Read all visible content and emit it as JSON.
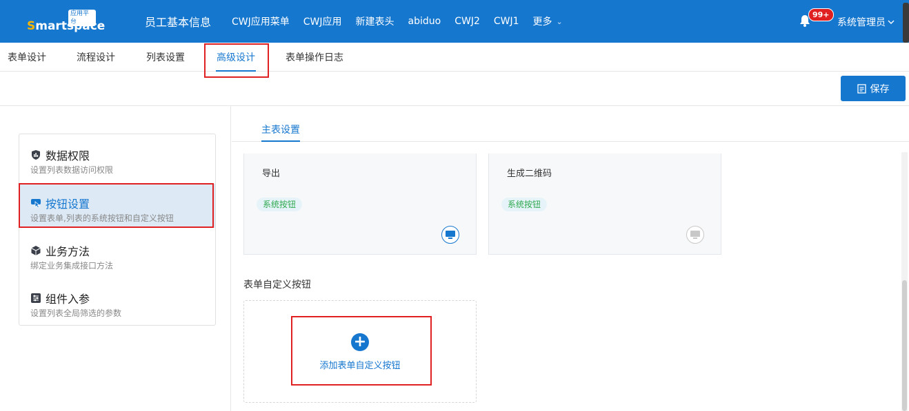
{
  "header": {
    "logo_badge": "应用平台",
    "logo_text_s": "S",
    "logo_text_rest": "martspace",
    "app_title": "员工基本信息",
    "nav_items": [
      "CWJ应用菜单",
      "CWJ应用",
      "新建表头",
      "abiduo",
      "CWJ2",
      "CWJ1"
    ],
    "more_label": "更多",
    "notification_count": "99+",
    "user_name": "系统管理员"
  },
  "tabs": [
    {
      "label": "表单设计"
    },
    {
      "label": "流程设计"
    },
    {
      "label": "列表设置"
    },
    {
      "label": "高级设计",
      "active": true
    },
    {
      "label": "表单操作日志"
    }
  ],
  "toolbar": {
    "save_label": "保存"
  },
  "menu": [
    {
      "title": "数据权限",
      "desc": "设置列表数据访问权限",
      "icon": "chart-shield-icon"
    },
    {
      "title": "按钮设置",
      "desc": "设置表单,列表的系统按钮和自定义按钮",
      "icon": "pointer-hand-icon",
      "active": true
    },
    {
      "title": "业务方法",
      "desc": "绑定业务集成接口方法",
      "icon": "cube-icon"
    },
    {
      "title": "组件入参",
      "desc": "设置列表全局筛选的参数",
      "icon": "sliders-icon"
    }
  ],
  "sub_tab": {
    "label": "主表设置"
  },
  "system_buttons": [
    {
      "name": "导出",
      "tag": "系统按钮",
      "enabled": true
    },
    {
      "name": "生成二维码",
      "tag": "系统按钮",
      "enabled": false
    }
  ],
  "custom_section": {
    "label": "表单自定义按钮",
    "add_label": "添加表单自定义按钮"
  },
  "colors": {
    "primary": "#1677cf",
    "highlight": "#e02020",
    "tag_green": "#2fa84f"
  }
}
